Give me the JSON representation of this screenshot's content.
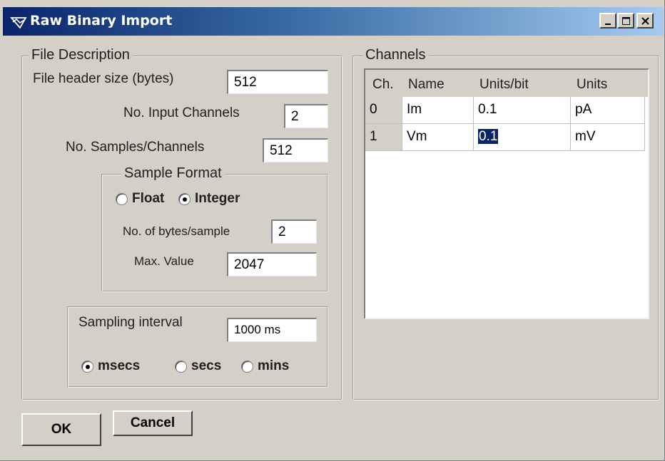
{
  "window": {
    "title": "Raw Binary Import"
  },
  "file_description": {
    "legend": "File Description",
    "header_size_label": "File header size (bytes)",
    "header_size_value": "512",
    "input_channels_label": "No. Input Channels",
    "input_channels_value": "2",
    "samples_label": "No. Samples/Channels",
    "samples_value": "512",
    "sample_format": {
      "legend": "Sample Format",
      "options": [
        {
          "label": "Float",
          "selected": false
        },
        {
          "label": "Integer",
          "selected": true
        }
      ],
      "bytes_label": "No. of bytes/sample",
      "bytes_value": "2",
      "max_label": "Max. Value",
      "max_value": "2047"
    },
    "sampling": {
      "label": "Sampling interval",
      "value": "1000 ms",
      "units": [
        {
          "label": "msecs",
          "selected": true
        },
        {
          "label": "secs",
          "selected": false
        },
        {
          "label": "mins",
          "selected": false
        }
      ]
    }
  },
  "channels": {
    "legend": "Channels",
    "columns": [
      "Ch.",
      "Name",
      "Units/bit",
      "Units"
    ],
    "rows": [
      {
        "ch": "0",
        "name": "Im",
        "units_per_bit": "0.1",
        "units": "pA"
      },
      {
        "ch": "1",
        "name": "Vm",
        "units_per_bit": "0.1",
        "units": "mV"
      }
    ]
  },
  "buttons": {
    "ok": "OK",
    "cancel": "Cancel"
  },
  "colors": {
    "title_start": "#0a246a",
    "title_end": "#a6caf0",
    "face": "#d4d0c8",
    "selection": "#0a246a"
  },
  "icons": [
    "app-icon",
    "minimize-icon",
    "maximize-icon",
    "close-icon"
  ]
}
